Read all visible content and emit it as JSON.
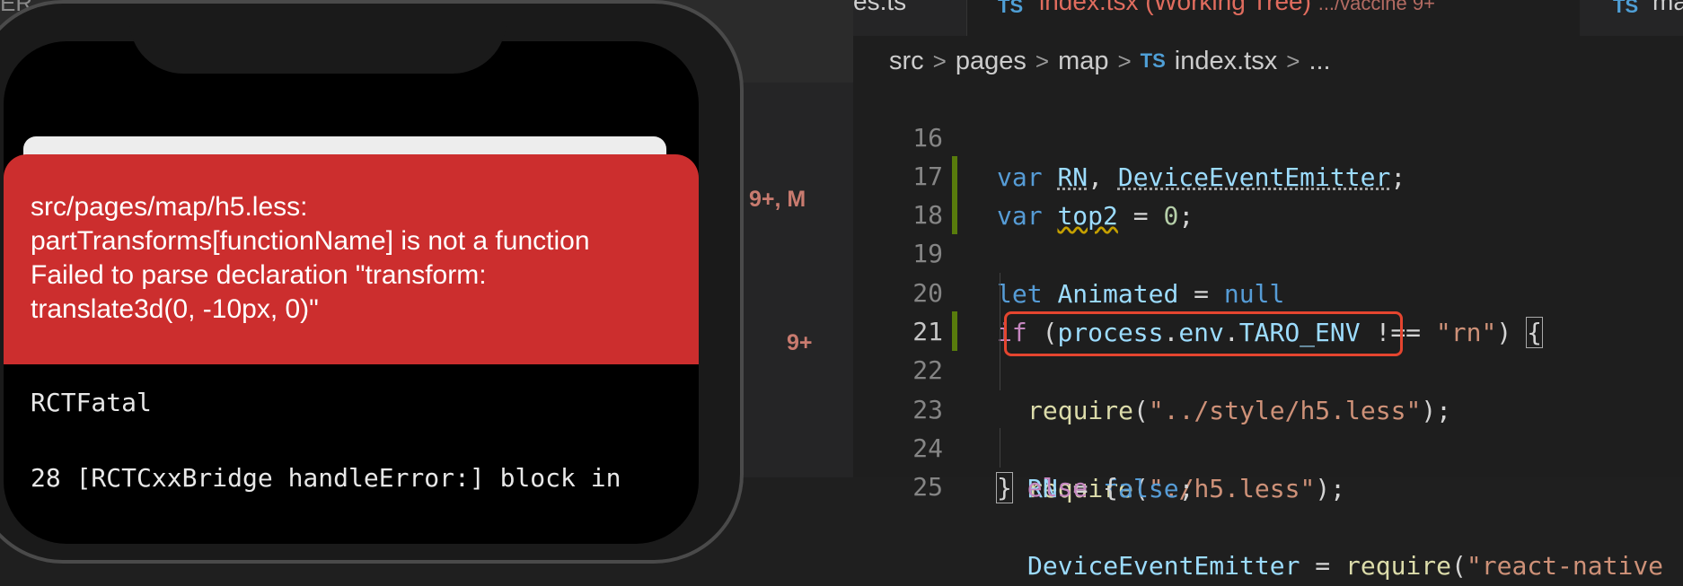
{
  "explorer": {
    "header": "ER",
    "partial_tab": "es.ts",
    "badges": [
      "9+, M",
      "9+"
    ]
  },
  "tabs": {
    "active": {
      "icon": "TS",
      "title": "index.tsx (Working Tree)",
      "path": ".../vaccine 9+"
    },
    "right": {
      "icon": "TS",
      "title": "ma"
    }
  },
  "breadcrumb": [
    "src",
    "pages",
    "map",
    "index.tsx",
    "..."
  ],
  "breadcrumb_file_icon": "TS",
  "breadcrumb_sep": ">",
  "lines": [
    {
      "n": "16"
    },
    {
      "n": "17"
    },
    {
      "n": "18"
    },
    {
      "n": "19"
    },
    {
      "n": "20"
    },
    {
      "n": "21"
    },
    {
      "n": "22"
    },
    {
      "n": "23"
    },
    {
      "n": "24"
    },
    {
      "n": "25"
    }
  ],
  "code": {
    "l16": {
      "kw": "var",
      "a": "RN",
      "sep": ",",
      "b": "DeviceEventEmitter",
      "end": ";"
    },
    "l17": {
      "kw": "var",
      "a": "top2",
      "eq": " = ",
      "num": "0",
      "end": ";"
    },
    "l18": {
      "kw": "let",
      "a": "Animated",
      "eq": " = ",
      "val": "null"
    },
    "l20": {
      "kw": "if",
      "open": " (",
      "obj": "process",
      "d1": ".",
      "p1": "env",
      "d2": ".",
      "p2": "TARO_ENV",
      "op": " !== ",
      "str": "\"rn\"",
      "close": ") ",
      "brace": "{"
    },
    "l21": {
      "fn": "require",
      "open": "(",
      "str": "\"../style/h5.less\"",
      "close": ");"
    },
    "l22": {
      "fn": "require",
      "open": "(",
      "str": "\"./h5.less\"",
      "close": ");"
    },
    "l23": {
      "a": "RN",
      "eq": " = ",
      "val": "false",
      "end": ";"
    },
    "l24": {
      "brace": "}",
      "kw": "else",
      "open": " {"
    },
    "l25": {
      "a": "DeviceEventEmitter",
      "eq": " = ",
      "fn": "require",
      "open": "(",
      "str": "\"react-native"
    }
  },
  "phone": {
    "error_message": "src/pages/map/h5.less: partTransforms[functionName] is not a function Failed to parse declaration \"transform: translate3d(0, -10px, 0)\"",
    "fatal": "RCTFatal",
    "stack": "28 [RCTCxxBridge handleError:] block in"
  },
  "colors": {
    "error_red": "#cc2e2e",
    "highlight": "#e5452f",
    "git_added": "#587c0c"
  }
}
